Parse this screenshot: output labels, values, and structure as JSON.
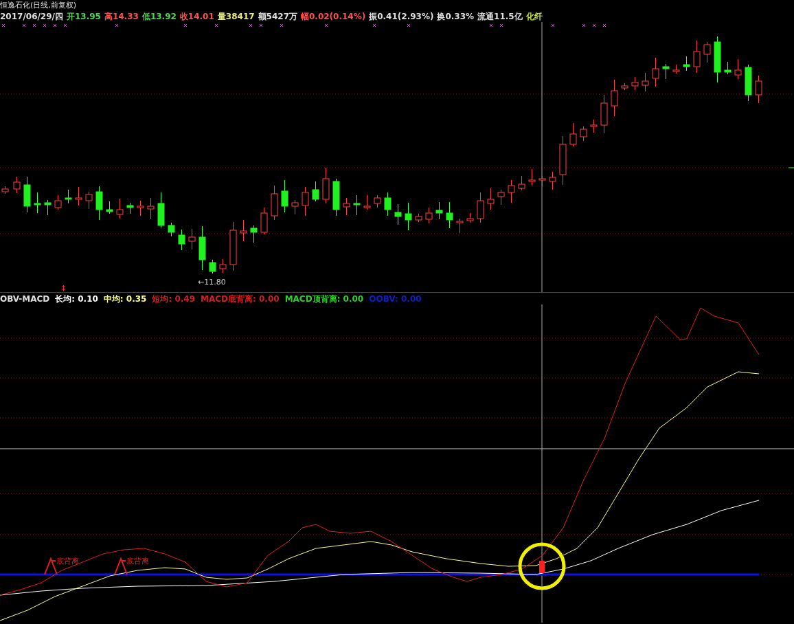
{
  "title": "恒逸石化(日线,前复权)",
  "quote": [
    {
      "text": "2017/06/29/四",
      "color": "#e0e0e0"
    },
    {
      "text": "开13.95",
      "color": "#4fd84f"
    },
    {
      "text": "高14.33",
      "color": "#ff5050"
    },
    {
      "text": "低13.92",
      "color": "#4fd84f"
    },
    {
      "text": "收14.01",
      "color": "#ff5050"
    },
    {
      "text": "量38417",
      "color": "#e8e880"
    },
    {
      "text": "额5427万",
      "color": "#e0e0e0"
    },
    {
      "text": "幅0.02(0.14%)",
      "color": "#ff5050"
    },
    {
      "text": "振0.41(2.93%)",
      "color": "#e0e0e0"
    },
    {
      "text": "换0.33%",
      "color": "#e0e0e0"
    },
    {
      "text": "流通11.5亿",
      "color": "#e0e0e0"
    },
    {
      "text": "化纤",
      "color": "#c0e040"
    }
  ],
  "price_chart": {
    "low_label": "←11.80"
  },
  "indicator": {
    "name": "OBV-MACD",
    "values": [
      {
        "text": "长均: 0.10",
        "color": "#ffffff"
      },
      {
        "text": "中均: 0.35",
        "color": "#ffff80"
      },
      {
        "text": "短均: 0.49",
        "color": "#d02020"
      },
      {
        "text": "MACD底背离: 0.00",
        "color": "#d02020"
      },
      {
        "text": "MACD顶背离: 0.00",
        "color": "#30d030"
      },
      {
        "text": "OOBV: 0.00",
        "color": "#1020c0"
      }
    ],
    "divergence_labels": [
      "底背离",
      "底背离"
    ]
  }
}
